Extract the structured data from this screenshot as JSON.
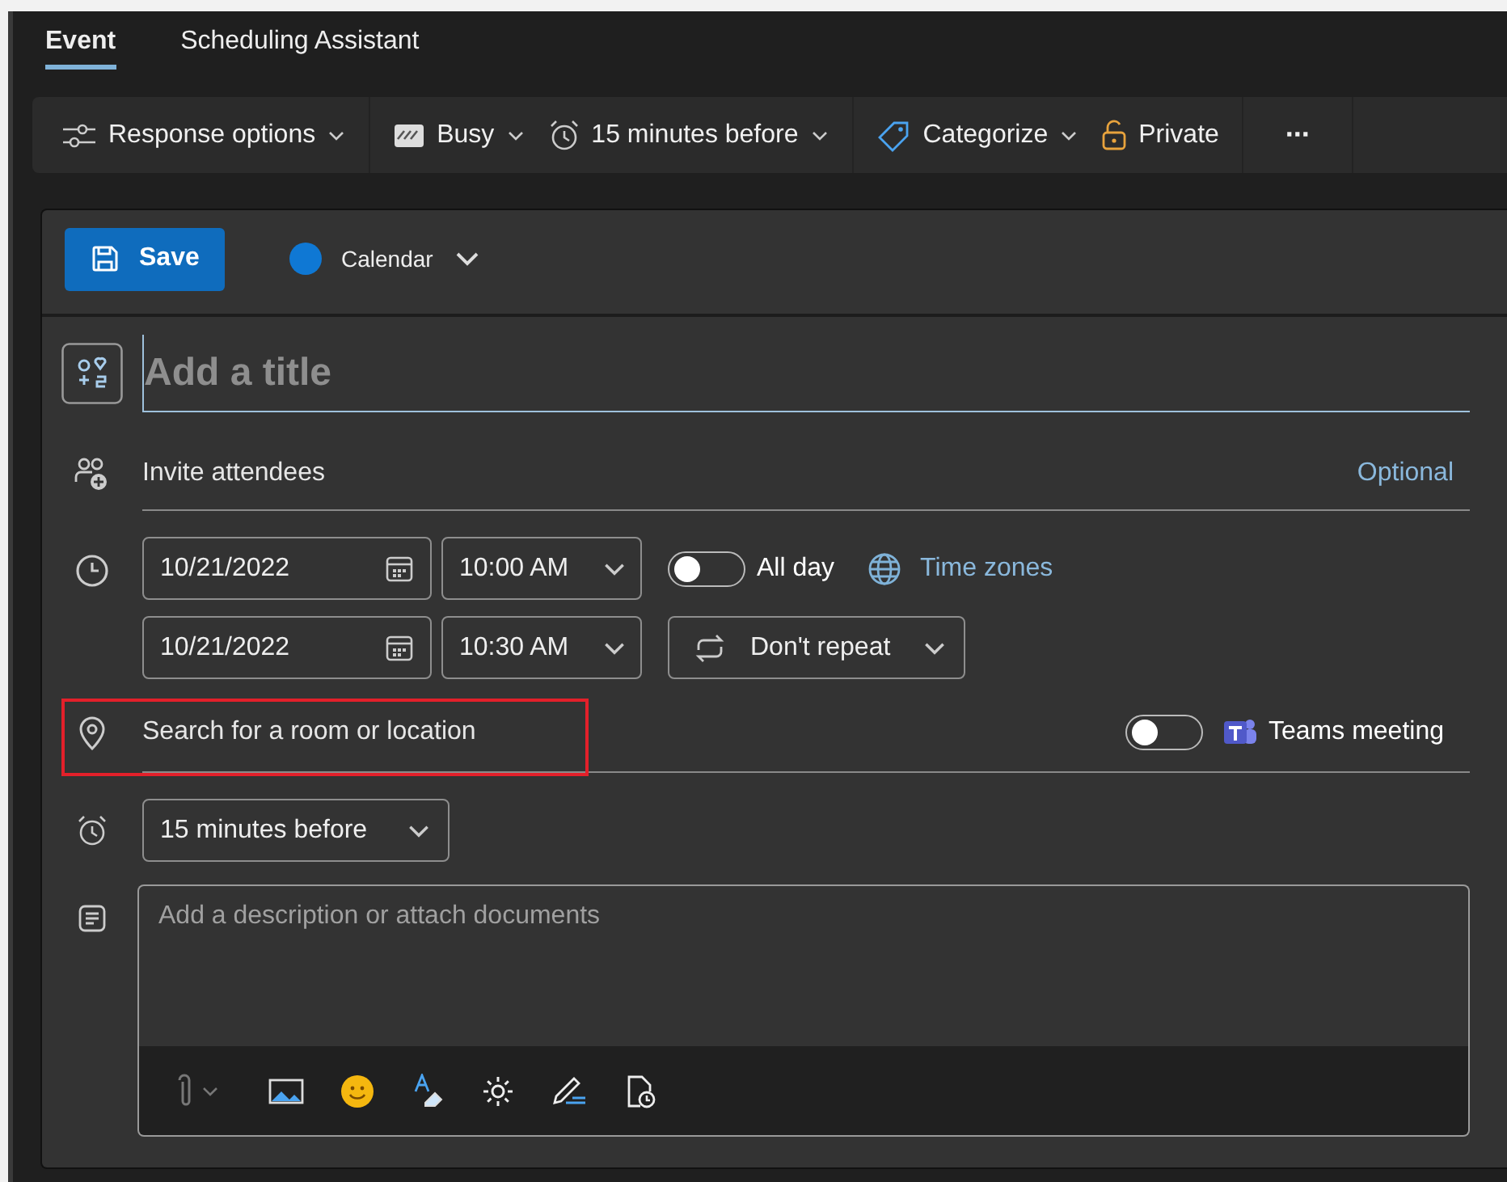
{
  "tabs": [
    {
      "label": "Event",
      "selected": true
    },
    {
      "label": "Scheduling Assistant",
      "selected": false
    }
  ],
  "toolbar": {
    "groups": [
      [
        {
          "kind": "dropdown",
          "label": "Response options"
        }
      ],
      [
        {
          "kind": "dropdown",
          "label": "Busy"
        },
        {
          "kind": "dropdown",
          "label": "15 minutes before"
        }
      ],
      [
        {
          "kind": "dropdown",
          "label": "Categorize"
        },
        {
          "kind": "button",
          "label": "Private"
        }
      ],
      [
        {
          "kind": "more",
          "label": "···"
        }
      ]
    ]
  },
  "form": {
    "save": "Save",
    "calendar": "Calendar",
    "title": {
      "placeholder": "Add a title"
    },
    "attendees": {
      "placeholder": "Invite attendees",
      "optional": "Optional"
    },
    "start": {
      "date": "10/21/2022",
      "time": "10:00 AM"
    },
    "end": {
      "date": "10/21/2022",
      "time": "10:30 AM"
    },
    "all_day": {
      "label": "All day",
      "on": false
    },
    "time_zones": "Time zones",
    "repeat": "Don't repeat",
    "location": {
      "placeholder": "Search for a room or location",
      "highlighted": true
    },
    "teams": {
      "label": "Teams meeting",
      "on": false
    },
    "reminder": "15 minutes before",
    "description": {
      "placeholder": "Add a description or attach documents"
    }
  }
}
